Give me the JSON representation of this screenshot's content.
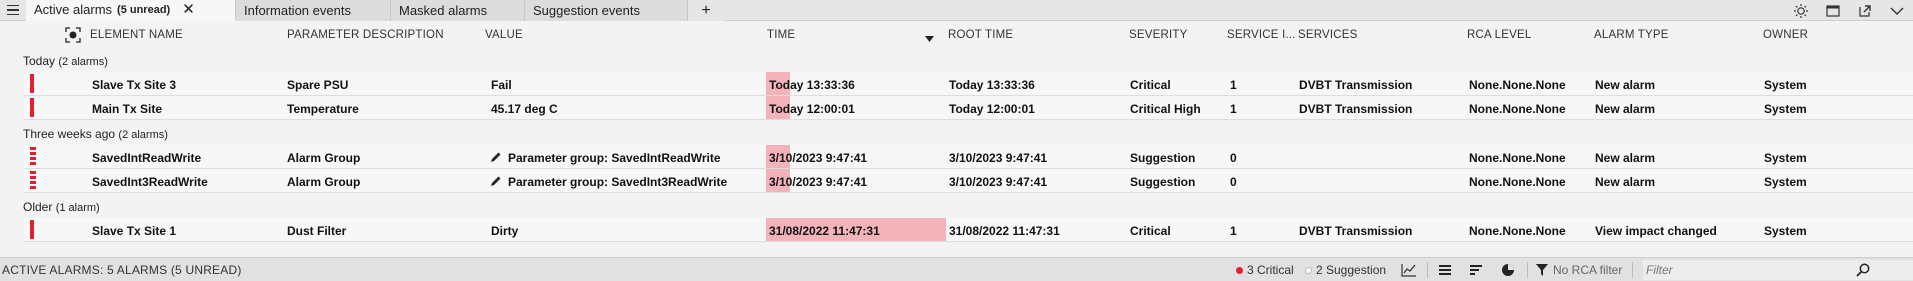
{
  "tabs": [
    {
      "label": "Active alarms",
      "badge": "(5 unread)"
    },
    {
      "label": "Information events"
    },
    {
      "label": "Masked alarms"
    },
    {
      "label": "Suggestion events"
    }
  ],
  "tab_close": "✕",
  "tab_add": "+",
  "columns": {
    "element_name": "ELEMENT NAME",
    "parameter_description": "PARAMETER DESCRIPTION",
    "value": "VALUE",
    "time": "TIME",
    "root_time": "ROOT TIME",
    "severity": "SEVERITY",
    "service_impact": "SERVICE I...",
    "services": "SERVICES",
    "rca_level": "RCA LEVEL",
    "alarm_type": "ALARM TYPE",
    "owner": "OWNER"
  },
  "groups": [
    {
      "label": "Today",
      "count": "(2 alarms)",
      "rows": [
        {
          "element": "Slave Tx Site 3",
          "parameter": "Spare PSU",
          "value": "Fail",
          "time": "Today 13:33:36",
          "root_time": "Today 13:33:36",
          "severity": "Critical",
          "service_impact": "1",
          "services": "DVBT Transmission",
          "rca_level": "None.None.None",
          "alarm_type": "New alarm",
          "owner": "System"
        },
        {
          "element": "Main Tx Site",
          "parameter": "Temperature",
          "value": "45.17 deg C",
          "time": "Today 12:00:01",
          "root_time": "Today 12:00:01",
          "severity": "Critical High",
          "service_impact": "1",
          "services": "DVBT Transmission",
          "rca_level": "None.None.None",
          "alarm_type": "New alarm",
          "owner": "System"
        }
      ]
    },
    {
      "label": "Three weeks ago",
      "count": "(2 alarms)",
      "rows": [
        {
          "element": "SavedIntReadWrite",
          "parameter": "Alarm Group",
          "value": "Parameter group: SavedIntReadWrite",
          "time": "3/10/2023 9:47:41",
          "root_time": "3/10/2023 9:47:41",
          "severity": "Suggestion",
          "service_impact": "0",
          "services": "",
          "rca_level": "None.None.None",
          "alarm_type": "New alarm",
          "owner": "System"
        },
        {
          "element": "SavedInt3ReadWrite",
          "parameter": "Alarm Group",
          "value": "Parameter group: SavedInt3ReadWrite",
          "time": "3/10/2023 9:47:41",
          "root_time": "3/10/2023 9:47:41",
          "severity": "Suggestion",
          "service_impact": "0",
          "services": "",
          "rca_level": "None.None.None",
          "alarm_type": "New alarm",
          "owner": "System"
        }
      ]
    },
    {
      "label": "Older",
      "count": "(1 alarm)",
      "rows": [
        {
          "element": "Slave Tx Site 1",
          "parameter": "Dust Filter",
          "value": "Dirty",
          "time": "31/08/2022 11:47:31",
          "root_time": "31/08/2022 11:47:31",
          "severity": "Critical",
          "service_impact": "1",
          "services": "DVBT Transmission",
          "rca_level": "None.None.None",
          "alarm_type": "View impact changed",
          "owner": "System"
        }
      ]
    }
  ],
  "status": {
    "summary": "ACTIVE ALARMS: 5 ALARMS (5 UNREAD)",
    "critical": "3 Critical",
    "suggestion": "2 Suggestion",
    "rca_filter": "No RCA filter",
    "filter_placeholder": "Filter"
  },
  "colors": {
    "critical": "#e02030",
    "time_highlight": "#f2b3ba",
    "suggestion": "#ffffff"
  }
}
